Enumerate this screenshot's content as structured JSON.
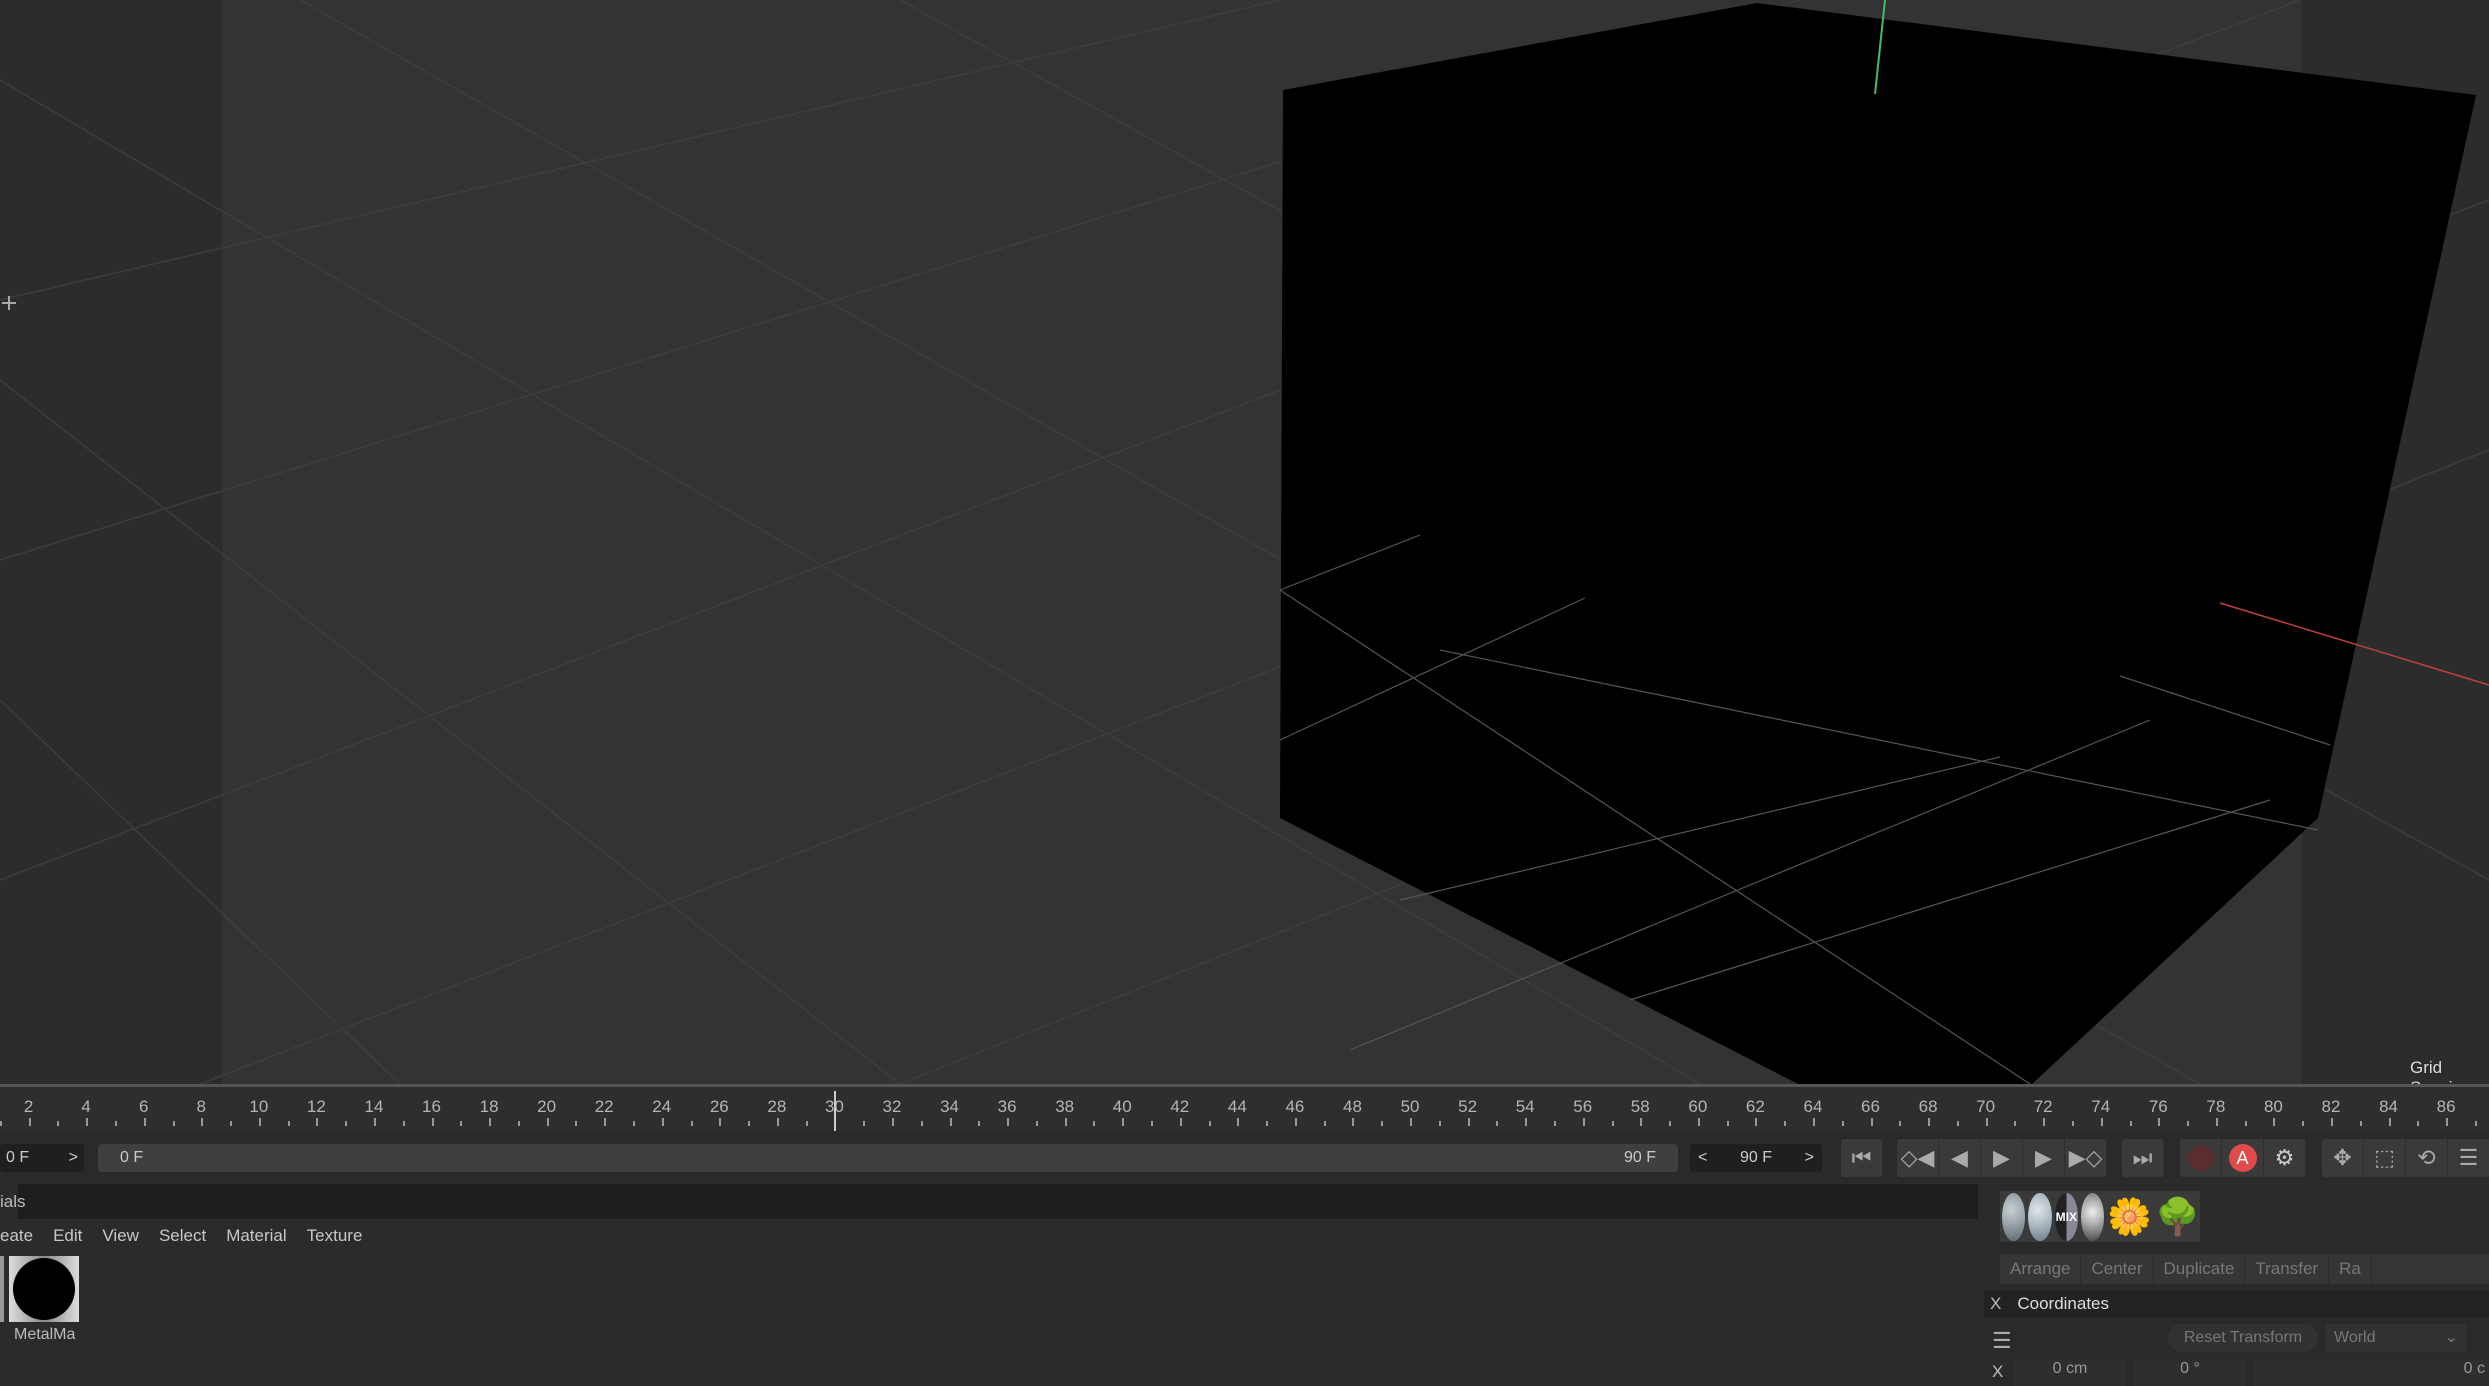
{
  "viewport": {
    "grid_label": "Grid Spaci"
  },
  "timeline": {
    "ticks": [
      2,
      4,
      6,
      8,
      10,
      12,
      14,
      16,
      18,
      20,
      22,
      24,
      26,
      28,
      30,
      32,
      34,
      36,
      38,
      40,
      42,
      44,
      46,
      48,
      50,
      52,
      54,
      56,
      58,
      60,
      62,
      64,
      66,
      68,
      70,
      72,
      74,
      76,
      78,
      80,
      82,
      84,
      86
    ],
    "playhead": 30
  },
  "framerow": {
    "current": "0 F",
    "range_start": "0 F",
    "range_end": "90 F",
    "end_field": "90 F",
    "prev": "<",
    "next": ">"
  },
  "materials": {
    "tab": "ials",
    "menu": [
      "eate",
      "Edit",
      "View",
      "Select",
      "Material",
      "Texture"
    ],
    "items": [
      {
        "name": "MetalMa"
      }
    ]
  },
  "colors": {
    "record": "#e04a4a",
    "accent": "#5b6bd0"
  },
  "right": {
    "toolbar": [
      "Arrange",
      "Center",
      "Duplicate",
      "Transfer",
      "Ra"
    ],
    "coordinates": {
      "title": "Coordinates",
      "close": "X",
      "reset": "Reset Transform",
      "space": "World",
      "axis": "X",
      "pos": "0 cm",
      "rot": "0 °",
      "scale": "0 c"
    },
    "mix_label": "MIX",
    "autokey_label": "A"
  }
}
